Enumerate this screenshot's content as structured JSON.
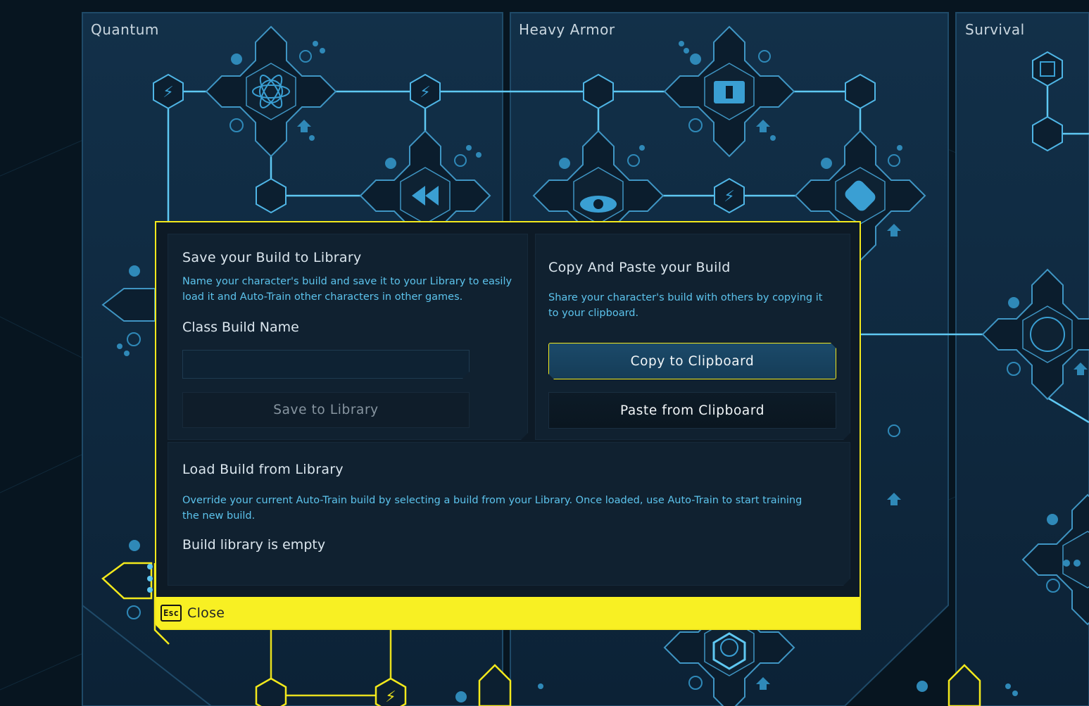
{
  "trees": [
    "Quantum",
    "Heavy Armor",
    "Survival"
  ],
  "modal": {
    "save": {
      "title": "Save your Build to Library",
      "description_line1": "Name your character's build and save it to your Library to easily",
      "description_line2": "load it and Auto-Train other characters in other games.",
      "name_label": "Class Build Name",
      "name_value": "",
      "button": "Save to Library"
    },
    "copy": {
      "title": "Copy And Paste your Build",
      "description_line1": "Share your character's build with others by copying it",
      "description_line2": "to your clipboard.",
      "copy_button": "Copy to Clipboard",
      "paste_button": "Paste from Clipboard"
    },
    "load": {
      "title": "Load Build from Library",
      "description_line1": "Override your current Auto-Train build by selecting a build from your Library. Once loaded, use Auto-Train to start training",
      "description_line2": "the new build.",
      "empty_text": "Build library is empty"
    },
    "close": {
      "key": "Esc",
      "label": "Close"
    }
  },
  "colors": {
    "accent": "#f3e91c",
    "link_blue": "#5cc3ec",
    "panel": "#102130",
    "background": "#071520"
  },
  "icons": [
    "lightning-icon",
    "atom-pause-icon",
    "rewind-icon",
    "shield-swirl-icon",
    "medkit-icon",
    "eye-icon",
    "bandage-icon",
    "chip-icon",
    "stopwatch-icon",
    "refresh-plus-icon",
    "house-icon",
    "target-icon",
    "dots-icon"
  ]
}
